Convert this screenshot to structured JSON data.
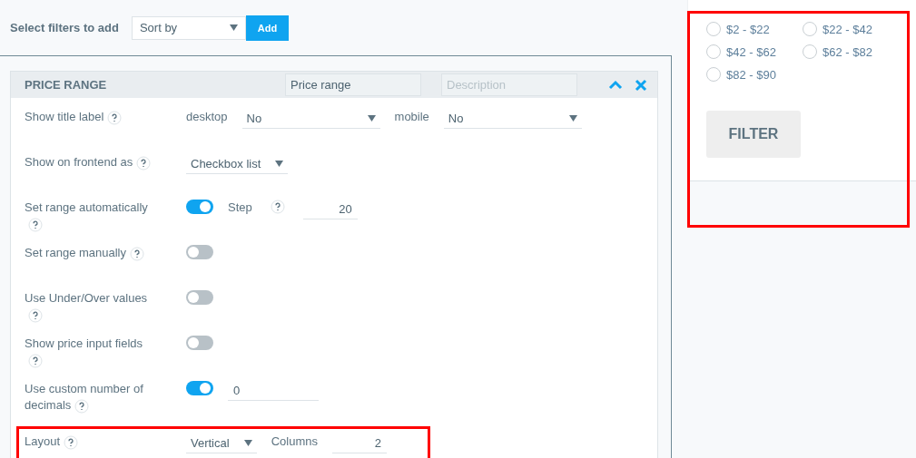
{
  "toolbar": {
    "label": "Select filters to add",
    "select": "Sort by",
    "button": "Add"
  },
  "panel": {
    "title": "PRICE RANGE",
    "title_field": {
      "value": "Price range"
    },
    "description_field": {
      "placeholder": "Description"
    },
    "rows": [
      {
        "label": "Show title label",
        "help": true,
        "highlighted": false,
        "controls": [
          {
            "kind": "text",
            "text": "desktop"
          },
          {
            "kind": "select",
            "value": "No"
          },
          {
            "kind": "text",
            "text": "mobile"
          },
          {
            "kind": "select",
            "value": "No"
          }
        ]
      },
      {
        "label": "Show on frontend as",
        "help": true,
        "highlighted": false,
        "controls": [
          {
            "kind": "compact_select",
            "value": "Checkbox list"
          }
        ]
      },
      {
        "label": "Set range automatically",
        "help": true,
        "highlighted": false,
        "controls": [
          {
            "kind": "toggle",
            "on": true
          },
          {
            "kind": "text",
            "text": "Step"
          },
          {
            "kind": "help"
          },
          {
            "kind": "input",
            "value": "20"
          }
        ]
      },
      {
        "label": "Set range manually",
        "help": true,
        "highlighted": false,
        "controls": [
          {
            "kind": "toggle",
            "on": false
          }
        ]
      },
      {
        "label": "Use Under/Over values",
        "help": true,
        "highlighted": false,
        "controls": [
          {
            "kind": "toggle",
            "on": false
          }
        ]
      },
      {
        "label": "Show price input fields",
        "help": true,
        "highlighted": false,
        "controls": [
          {
            "kind": "toggle",
            "on": false
          }
        ]
      },
      {
        "label": "Use custom number of decimals",
        "help": true,
        "highlighted": false,
        "controls": [
          {
            "kind": "toggle",
            "on": true
          },
          {
            "kind": "wide_input",
            "value": "0"
          }
        ]
      },
      {
        "label": "Layout",
        "help": true,
        "highlighted": true,
        "controls": [
          {
            "kind": "compact_select",
            "value": "Vertical"
          },
          {
            "kind": "text",
            "text": "Columns"
          },
          {
            "kind": "input",
            "value": "2"
          }
        ]
      }
    ]
  },
  "preview": {
    "highlighted": true,
    "options": [
      {
        "label": "$2 - $22",
        "selected": false
      },
      {
        "label": "$22 - $42",
        "selected": false
      },
      {
        "label": "$42 - $62",
        "selected": false
      },
      {
        "label": "$62 - $82",
        "selected": false
      },
      {
        "label": "$82 - $90",
        "selected": false
      }
    ],
    "button": "FILTER"
  }
}
